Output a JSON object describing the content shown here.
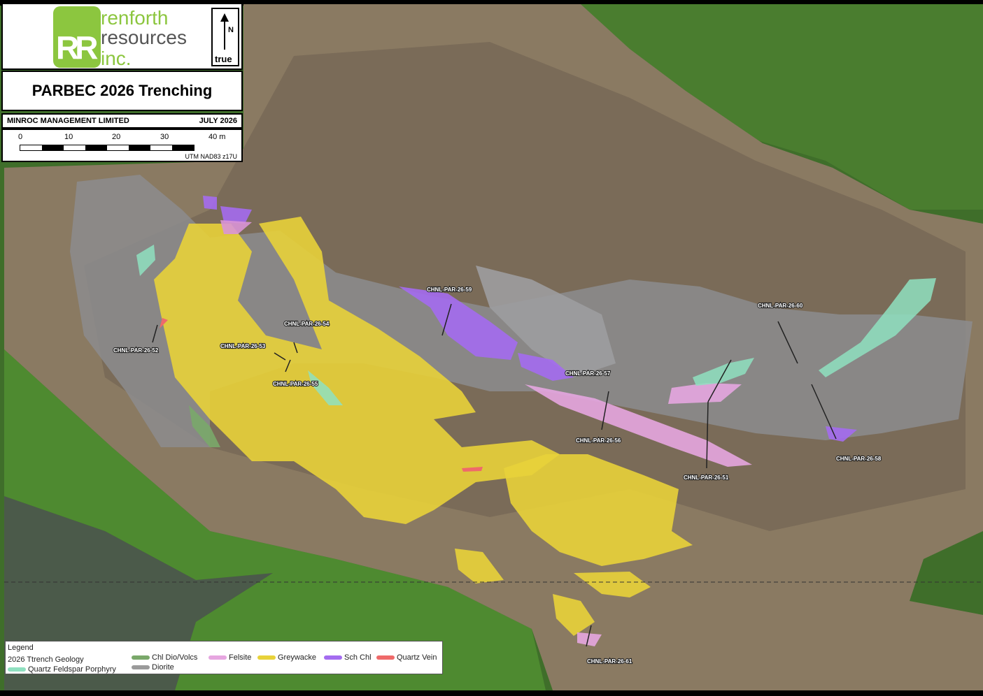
{
  "header": {
    "logo_line1": "renforth",
    "logo_line2": "resources",
    "logo_line3": "inc.",
    "logo_mark": "RR",
    "north_letter": "N",
    "north_label": "true",
    "title": "PARBEC 2026 Trenching",
    "company": "MINROC MANAGEMENT LIMITED",
    "date": "JULY 2026"
  },
  "scale": {
    "ticks": [
      "0",
      "10",
      "20",
      "30",
      "40 m"
    ],
    "crs": "UTM NAD83 z17U"
  },
  "legend": {
    "title": "Legend",
    "subtitle": "2026 Ttrench Geology",
    "units": [
      {
        "label": "Chl Dio/Volcs",
        "color": "#7aa86a"
      },
      {
        "label": "Felsite",
        "color": "#e6a6e0"
      },
      {
        "label": "Greywacke",
        "color": "#e8d23a"
      },
      {
        "label": "Sch Chl",
        "color": "#a46cf0"
      },
      {
        "label": "Quartz Vein",
        "color": "#ef6a6a"
      },
      {
        "label": "Quartz Feldspar Porphyry",
        "color": "#8fe0c0"
      },
      {
        "label": "Diorite",
        "color": "#9a9a9a"
      }
    ]
  },
  "trenches": [
    {
      "label": "CHNL-PAR-26-52"
    },
    {
      "label": "CHNL-PAR-26-53"
    },
    {
      "label": "CHNL-PAR-26-54"
    },
    {
      "label": "CHNL-PAR-26-55"
    },
    {
      "label": "CHNL-PAR-26-59"
    },
    {
      "label": "CHNL-PAR-26-57"
    },
    {
      "label": "CHNL-PAR-26-56"
    },
    {
      "label": "CHNL-PAR-26-51"
    },
    {
      "label": "CHNL-PAR-26-60"
    },
    {
      "label": "CHNL-PAR-26-58"
    },
    {
      "label": "CHNL-PAR-26-61"
    }
  ]
}
